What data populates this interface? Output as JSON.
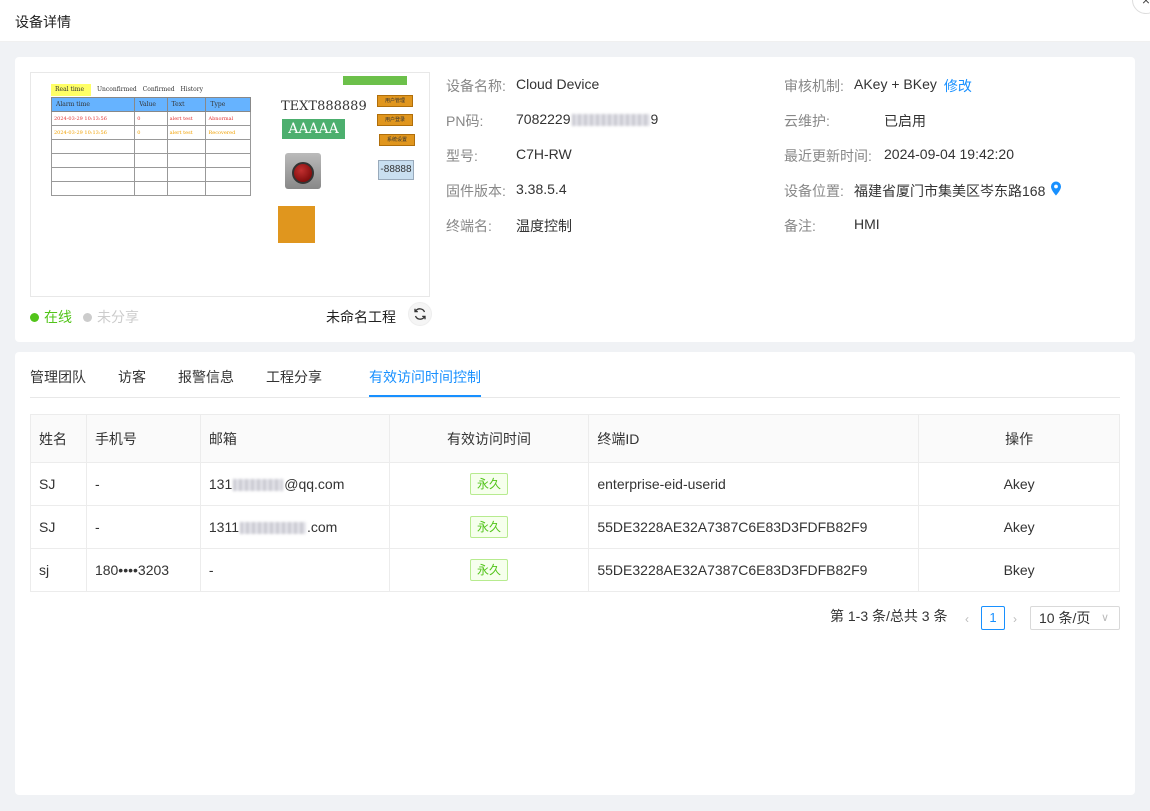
{
  "modal": {
    "title": "设备详情",
    "close_icon": "×"
  },
  "preview": {
    "tab_realtime": "Real time",
    "tab_others": "Unconfirmed  Confirmed  History",
    "alarm_table": {
      "headers": [
        "Alarm time",
        "Value",
        "Text",
        "Type"
      ],
      "rows": [
        [
          "2024-03-29 10:13:56",
          "0",
          "alert test",
          "Abnormal"
        ],
        [
          "2024-03-29 10:13:56",
          "0",
          "alert test",
          "Recovered"
        ]
      ]
    },
    "text_label": "TEXT888889",
    "aaaaa_label": "AAAAA",
    "btn_user_mgmt": "用户管理",
    "btn_user_login": "用户登录",
    "btn_sys_settings": "系统设置",
    "numeric_display": "-88888"
  },
  "status": {
    "online": "在线",
    "unshared": "未分享",
    "project_name": "未命名工程",
    "online_color": "#52c41a",
    "unshared_color": "#cccccc"
  },
  "device_info": {
    "name_label": "设备名称:",
    "name_value": "Cloud Device",
    "pn_label": "PN码:",
    "pn_prefix": "7082229",
    "pn_suffix": "9",
    "model_label": "型号:",
    "model_value": "C7H-RW",
    "firmware_label": "固件版本:",
    "firmware_value": "3.38.5.4",
    "terminal_label": "终端名:",
    "terminal_value": "温度控制",
    "audit_label": "审核机制:",
    "audit_value": "AKey + BKey",
    "audit_edit": "修改",
    "cloud_label": "云维护:",
    "cloud_value": "已启用",
    "updated_label": "最近更新时间:",
    "updated_value": "2024-09-04 19:42:20",
    "location_label": "设备位置:",
    "location_value": "福建省厦门市集美区岑东路168",
    "remark_label": "备注:",
    "remark_value": "HMI"
  },
  "tabs": [
    "管理团队",
    "访客",
    "报警信息",
    "工程分享",
    "有效访问时间控制"
  ],
  "access_table": {
    "headers": [
      "姓名",
      "手机号",
      "邮箱",
      "有效访问时间",
      "终端ID",
      "操作"
    ],
    "rows": [
      {
        "name": "SJ",
        "phone": "-",
        "email_prefix": "131",
        "email_suffix": "@qq.com",
        "access": "永久",
        "terminal_id": "enterprise-eid-userid",
        "op": "Akey"
      },
      {
        "name": "SJ",
        "phone": "-",
        "email_prefix": "1311",
        "email_suffix": ".com",
        "access": "永久",
        "terminal_id": "55DE3228AE32A7387C6E83D3FDFB82F9",
        "op": "Akey"
      },
      {
        "name": "sj",
        "phone": "180••••3203",
        "email_prefix": "-",
        "email_suffix": "",
        "access": "永久",
        "terminal_id": "55DE3228AE32A7387C6E83D3FDFB82F9",
        "op": "Bkey"
      }
    ]
  },
  "pagination": {
    "summary": "第 1-3 条/总共 3 条",
    "current_page": "1",
    "page_size": "10 条/页",
    "prev_icon": "‹",
    "next_icon": "›",
    "dropdown_icon": "∨"
  }
}
